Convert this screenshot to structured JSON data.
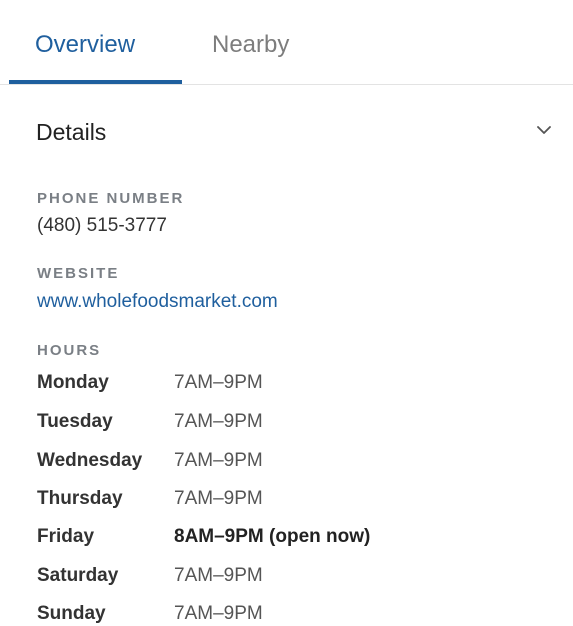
{
  "tabs": [
    {
      "label": "Overview",
      "selected": true
    },
    {
      "label": "Nearby",
      "selected": false
    }
  ],
  "details": {
    "title": "Details",
    "expanded": true,
    "icon": "chevron-down-icon"
  },
  "phone": {
    "label": "PHONE NUMBER",
    "value": "(480) 515-3777"
  },
  "website": {
    "label": "WEBSITE",
    "value": "www.wholefoodsmarket.com"
  },
  "hours": {
    "label": "HOURS",
    "rows": [
      {
        "day": "Monday",
        "time": "7AM–9PM"
      },
      {
        "day": "Tuesday",
        "time": "7AM–9PM"
      },
      {
        "day": "Wednesday",
        "time": "7AM–9PM"
      },
      {
        "day": "Thursday",
        "time": "7AM–9PM"
      },
      {
        "day": "Friday",
        "time": "8AM–9PM (open now)",
        "today": true
      },
      {
        "day": "Saturday",
        "time": "7AM–9PM"
      },
      {
        "day": "Sunday",
        "time": "7AM–9PM"
      }
    ]
  },
  "colors": {
    "accent": "#1f5f9e",
    "muted_label": "#7a7f85",
    "text": "#333333"
  }
}
